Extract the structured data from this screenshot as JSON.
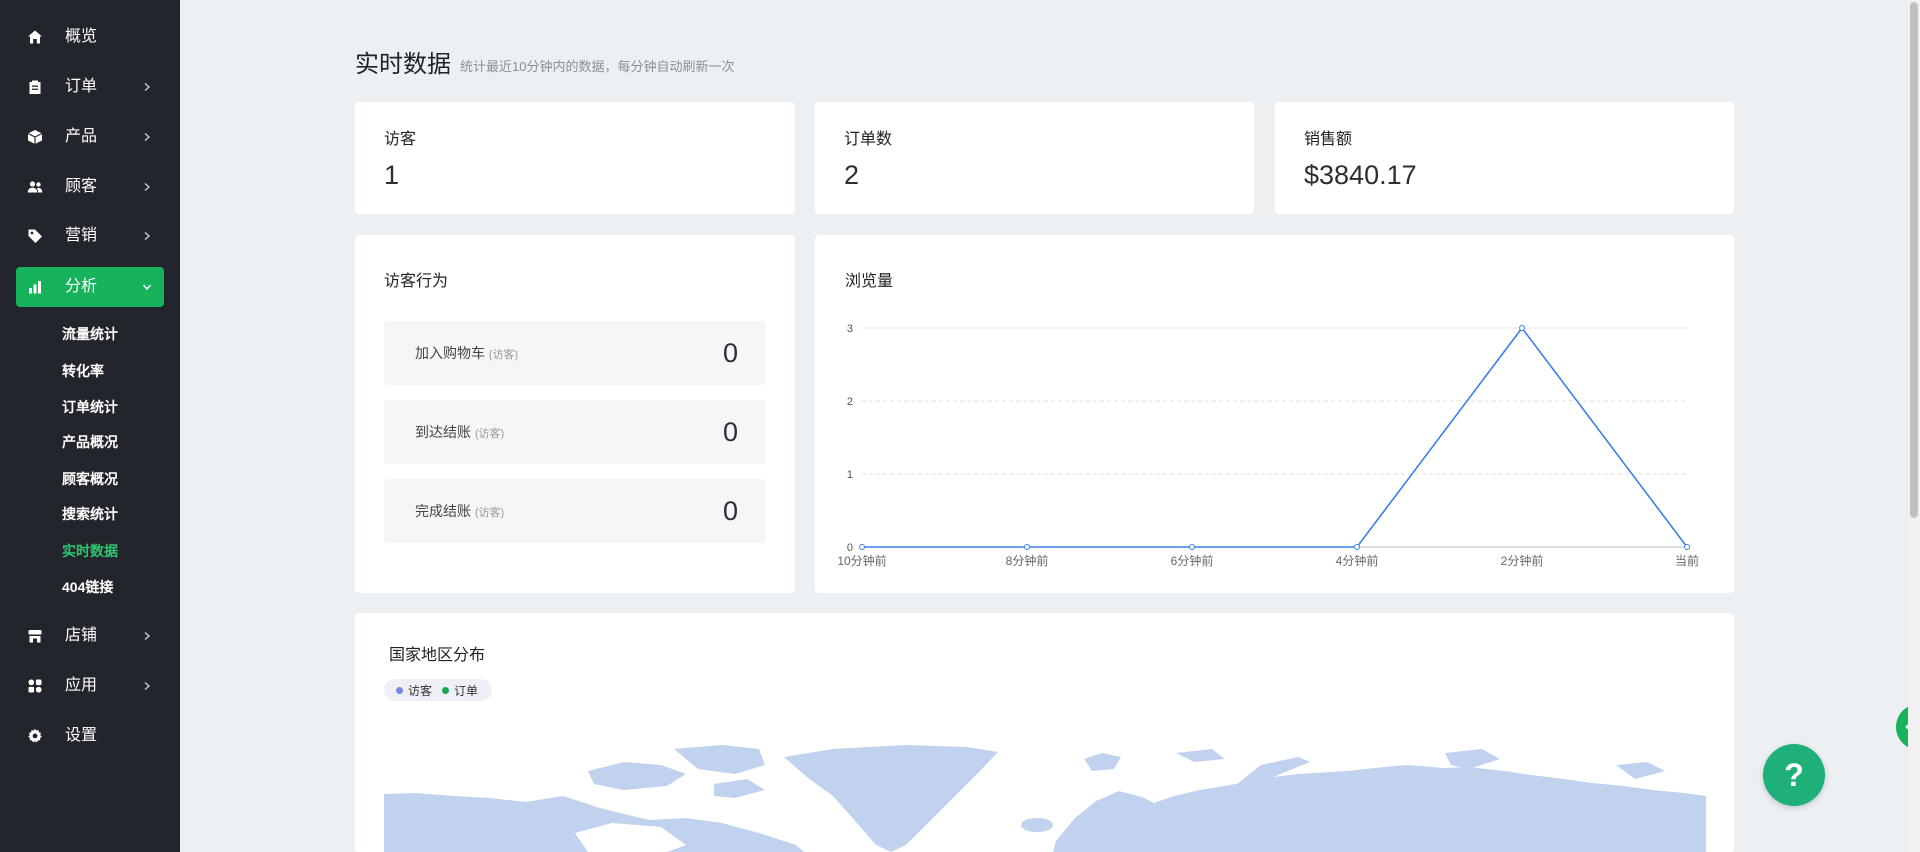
{
  "sidebar": {
    "items": [
      {
        "label": "概览",
        "icon": "home-icon"
      },
      {
        "label": "订单",
        "icon": "clipboard-icon"
      },
      {
        "label": "产品",
        "icon": "box-icon"
      },
      {
        "label": "顾客",
        "icon": "users-icon"
      },
      {
        "label": "营销",
        "icon": "tag-icon"
      },
      {
        "label": "分析",
        "icon": "bar-chart-icon",
        "active": true,
        "expanded": true
      },
      {
        "label": "店铺",
        "icon": "store-icon"
      },
      {
        "label": "应用",
        "icon": "apps-icon"
      },
      {
        "label": "设置",
        "icon": "gear-icon"
      }
    ],
    "analytics_sub": [
      {
        "label": "流量统计"
      },
      {
        "label": "转化率"
      },
      {
        "label": "订单统计"
      },
      {
        "label": "产品概况"
      },
      {
        "label": "顾客概况"
      },
      {
        "label": "搜索统计"
      },
      {
        "label": "实时数据",
        "active": true
      },
      {
        "label": "404链接"
      }
    ]
  },
  "page": {
    "title": "实时数据",
    "subtitle": "统计最近10分钟内的数据，每分钟自动刷新一次"
  },
  "stats": [
    {
      "label": "访客",
      "value": "1"
    },
    {
      "label": "订单数",
      "value": "2"
    },
    {
      "label": "销售额",
      "value": "$3840.17"
    }
  ],
  "visitor_behavior": {
    "title": "访客行为",
    "rows": [
      {
        "label": "加入购物车",
        "note": "(访客)",
        "value": "0"
      },
      {
        "label": "到达结账",
        "note": "(访客)",
        "value": "0"
      },
      {
        "label": "完成结账",
        "note": "(访客)",
        "value": "0"
      }
    ]
  },
  "chart_data": {
    "type": "line",
    "title": "浏览量",
    "categories": [
      "10分钟前",
      "8分钟前",
      "6分钟前",
      "4分钟前",
      "2分钟前",
      "当前"
    ],
    "values": [
      0,
      0,
      0,
      0,
      3,
      0
    ],
    "yticks": [
      "0",
      "1",
      "2",
      "3"
    ],
    "ylim": [
      0,
      3
    ],
    "grid": true,
    "legend": "none"
  },
  "geo": {
    "title": "国家地区分布",
    "legend": [
      {
        "label": "访客",
        "color": "#7286e6"
      },
      {
        "label": "订单",
        "color": "#18a84e"
      }
    ]
  },
  "help": {
    "label": "?"
  },
  "colors": {
    "sidebar_bg": "#22262c",
    "accent": "#16b25c",
    "active_sub_text": "#2fc46f",
    "chart_line": "#3b7fe8",
    "grid": "#dcdfe3",
    "axis": "#b9bec5",
    "map_land": "#c0d2ee",
    "help_button": "#1fb07a",
    "page_bg": "#ecf0f3"
  }
}
